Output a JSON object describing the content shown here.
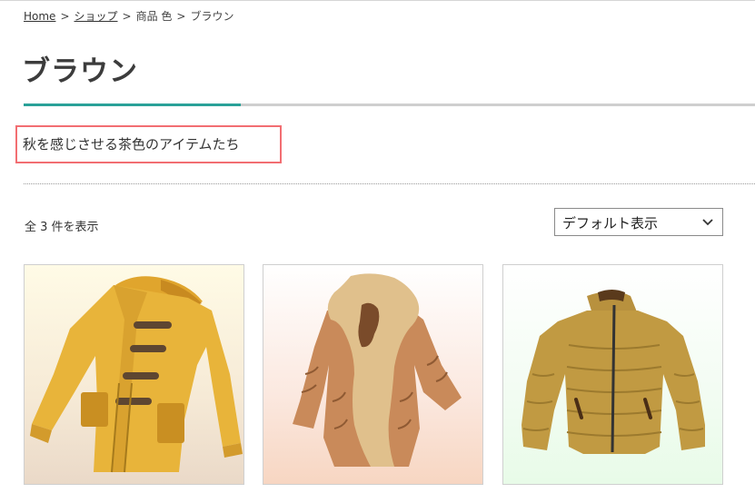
{
  "breadcrumb": {
    "home": "Home",
    "sep1": ">",
    "shop": "ショップ",
    "sep2": ">",
    "category": "商品 色",
    "sep3": ">",
    "current": "ブラウン"
  },
  "page": {
    "title": "ブラウン",
    "description": "秋を感じさせる茶色のアイテムたち"
  },
  "results": {
    "count_text": "全 3 件を表示"
  },
  "sort": {
    "selected": "デフォルト表示",
    "icon": "chevron-down-icon"
  },
  "products": [
    {
      "image": "duffle-coat-yellow"
    },
    {
      "image": "fur-collar-coat-brown"
    },
    {
      "image": "down-jacket-khaki"
    }
  ],
  "colors": {
    "accent": "#2aa198",
    "highlight_border": "#f26e72",
    "title": "#3c3c3c"
  }
}
